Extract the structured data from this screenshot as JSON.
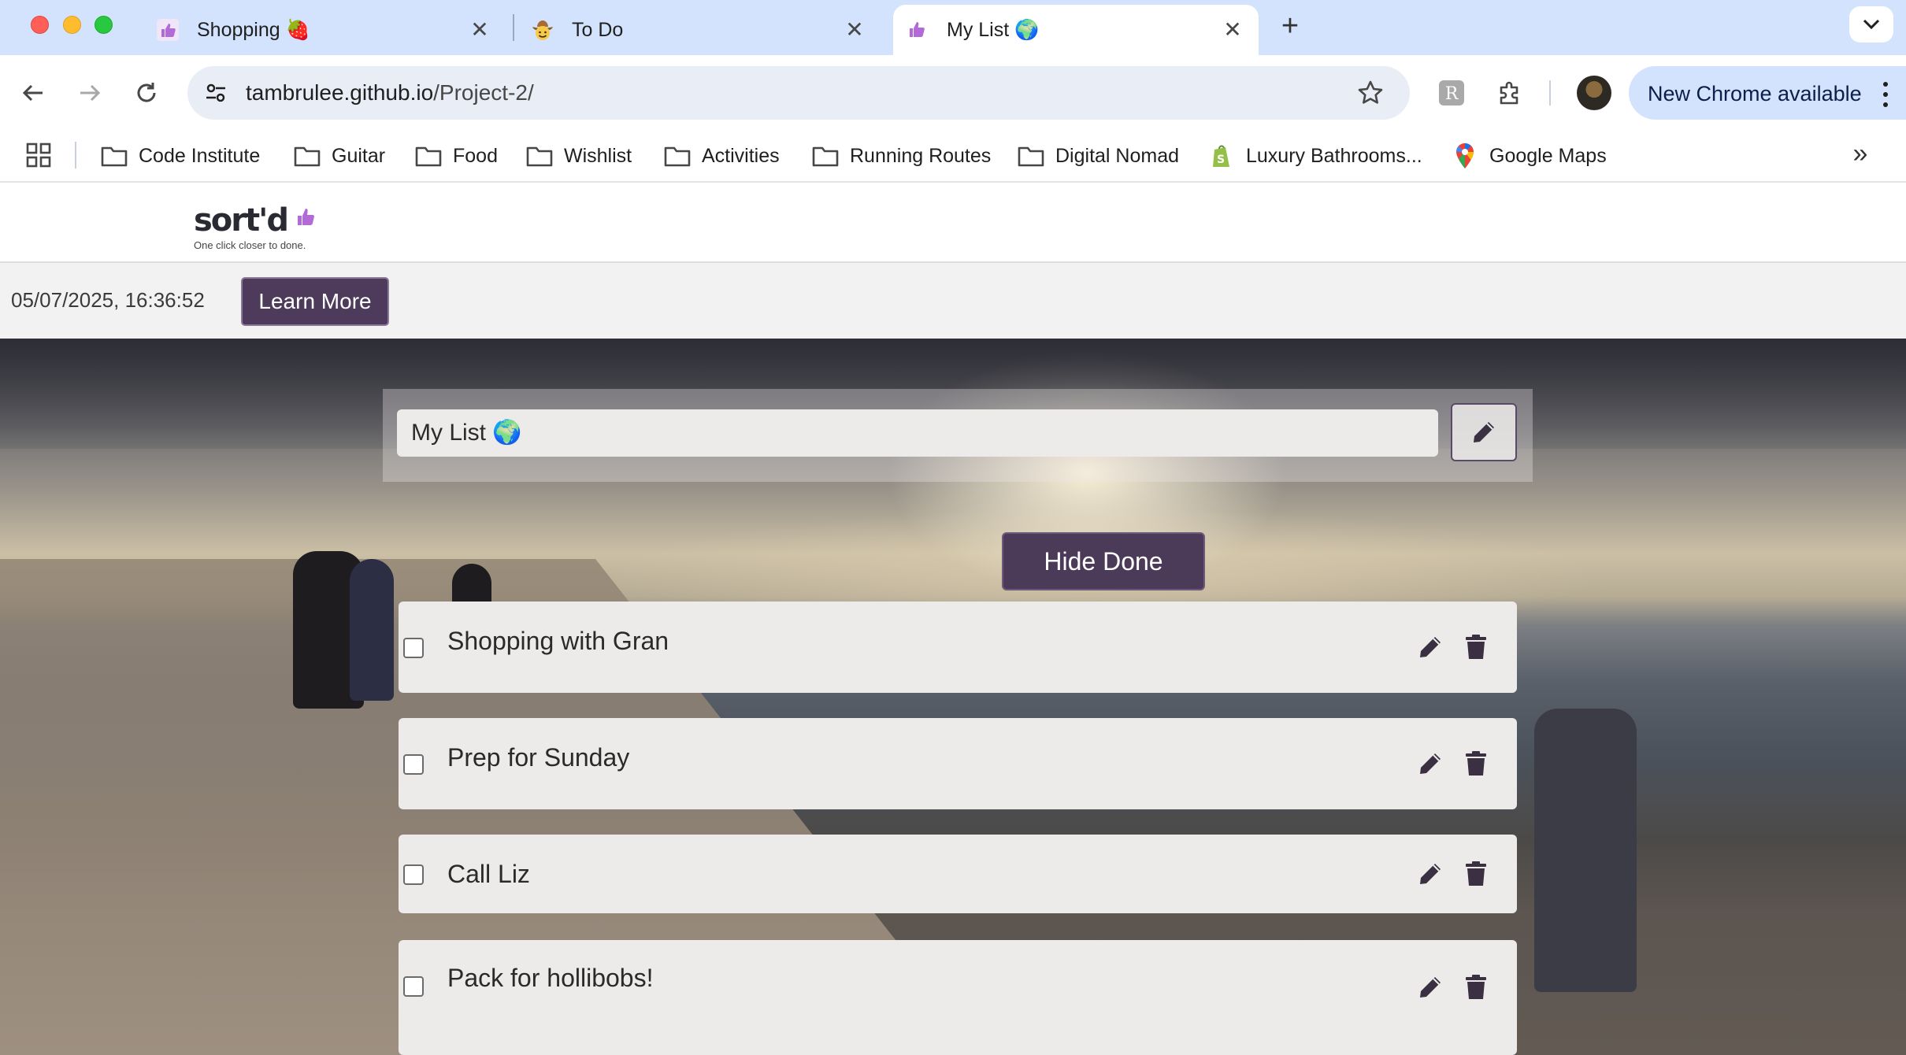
{
  "browser": {
    "tabs": [
      {
        "title": "Shopping 🍓",
        "favicon": "thumbs-up-icon",
        "active": false
      },
      {
        "title": "To Do",
        "favicon": "cowboy-emoji-icon",
        "active": false
      },
      {
        "title": "My List 🌍",
        "favicon": "thumbs-up-icon",
        "active": true
      }
    ],
    "new_tab": "+",
    "address": {
      "host": "tambrulee.github.io",
      "path": "/Project-2/"
    },
    "update_label": "New Chrome available",
    "bookmarks": [
      {
        "label": "Code Institute",
        "icon": "folder-icon"
      },
      {
        "label": "Guitar",
        "icon": "folder-icon"
      },
      {
        "label": "Food",
        "icon": "folder-icon"
      },
      {
        "label": "Wishlist",
        "icon": "folder-icon"
      },
      {
        "label": "Activities",
        "icon": "folder-icon"
      },
      {
        "label": "Running Routes",
        "icon": "folder-icon"
      },
      {
        "label": "Digital Nomad",
        "icon": "folder-icon"
      },
      {
        "label": "Luxury Bathrooms...",
        "icon": "shopify-icon"
      },
      {
        "label": "Google Maps",
        "icon": "map-pin-icon"
      }
    ],
    "more_bookmarks": "»"
  },
  "site": {
    "logo_text": "sort'd",
    "tagline": "One click closer to done.",
    "datetime": "05/07/2025, 16:36:52",
    "learn_more": "Learn More",
    "list_title": "My List 🌍",
    "hide_done": "Hide Done",
    "todos": [
      {
        "text": "Shopping with Gran",
        "done": false
      },
      {
        "text": "Prep for Sunday",
        "done": false
      },
      {
        "text": "Call Liz",
        "done": false
      },
      {
        "text": "Pack for hollibobs!",
        "done": false
      }
    ],
    "colors": {
      "accent": "#4c3a59",
      "brand_thumb": "#b16ad6"
    }
  }
}
